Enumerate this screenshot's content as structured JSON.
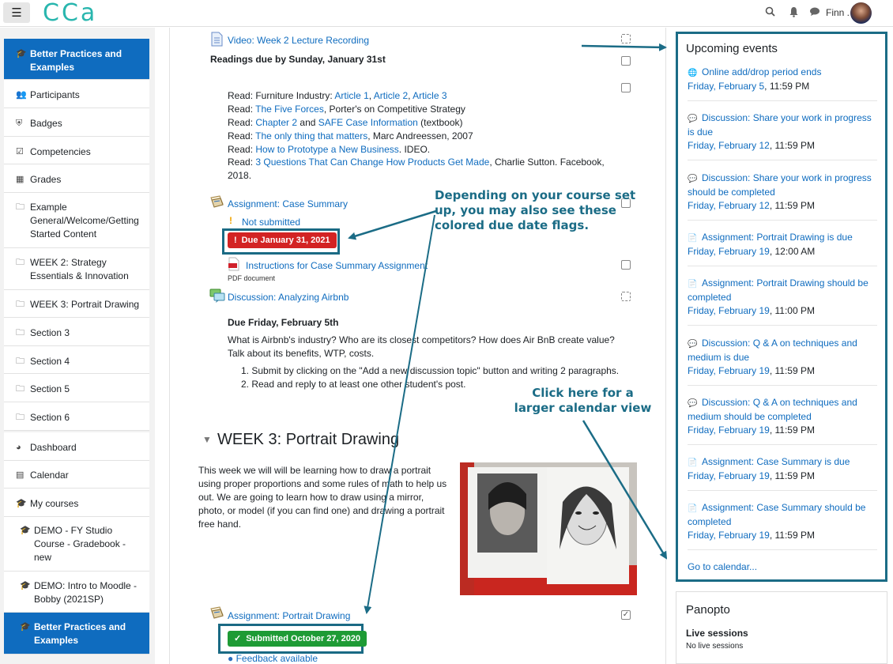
{
  "topbar": {
    "logo_text": "CCa",
    "user_name": "Finn ."
  },
  "leftnav": {
    "items": [
      {
        "label": "Better Practices and Examples",
        "icon": "graduation-cap-icon",
        "active": true
      },
      {
        "label": "Participants",
        "icon": "users-icon"
      },
      {
        "label": "Badges",
        "icon": "shield-icon"
      },
      {
        "label": "Competencies",
        "icon": "checkbox-icon"
      },
      {
        "label": "Grades",
        "icon": "table-icon"
      },
      {
        "label": "Example General/Welcome/Getting Started Content",
        "icon": "folder-icon"
      },
      {
        "label": "WEEK 2: Strategy Essentials & Innovation",
        "icon": "folder-icon"
      },
      {
        "label": "WEEK 3: Portrait Drawing",
        "icon": "folder-icon"
      },
      {
        "label": "Section 3",
        "icon": "folder-icon"
      },
      {
        "label": "Section 4",
        "icon": "folder-icon"
      },
      {
        "label": "Section 5",
        "icon": "folder-icon"
      },
      {
        "label": "Section 6",
        "icon": "folder-icon"
      }
    ],
    "items2": [
      {
        "label": "Dashboard",
        "icon": "dashboard-icon"
      },
      {
        "label": "Calendar",
        "icon": "calendar-icon"
      },
      {
        "label": "My courses",
        "icon": "graduation-cap-icon"
      },
      {
        "label": "DEMO - FY Studio Course - Gradebook - new",
        "icon": "graduation-cap-icon"
      },
      {
        "label": "DEMO: Intro to Moodle - Bobby (2021SP)",
        "icon": "graduation-cap-icon"
      },
      {
        "label": "Better Practices and Examples",
        "icon": "graduation-cap-icon",
        "active": true
      }
    ]
  },
  "main": {
    "video_link": "Video: Week 2 Lecture Recording",
    "readings_heading": "Readings due by Sunday, January 31st",
    "readings": {
      "r1_prefix": "Read: Furniture Industry: ",
      "r1_a1": "Article 1",
      "r1_a2": "Article 2",
      "r1_a3": "Article 3",
      "r2_prefix": "Read: ",
      "r2_link": "The Five Forces",
      "r2_suffix": ", Porter's on Competitive Strategy",
      "r3_prefix": "Read: ",
      "r3_link1": "Chapter 2",
      "r3_mid": " and ",
      "r3_link2": "SAFE Case Information",
      "r3_suffix": " (textbook)",
      "r4_prefix": "Read: ",
      "r4_link": "The only thing that matters",
      "r4_suffix": ", Marc Andreessen, 2007",
      "r5_prefix": "Read: ",
      "r5_link": "How to Prototype a New Business",
      "r5_suffix": ". IDEO.",
      "r6_prefix": "Read: ",
      "r6_link": "3 Questions That Can Change How Products Get Made",
      "r6_suffix": ", Charlie Sutton. Facebook,",
      "r6_line2": "2018."
    },
    "case_assignment": "Assignment: Case Summary",
    "not_submitted": "Not submitted",
    "due_flag": "Due January 31, 2021",
    "instructions_link": "Instructions for Case Summary Assignment",
    "pdf_label": "PDF document",
    "discussion_link": "Discussion: Analyzing Airbnb",
    "due_friday": "Due Friday, February 5th",
    "discussion_text": "What is Airbnb's industry? Who are its closest competitors? How does Air BnB create value? Talk about its benefits, WTP, costs.",
    "steps": [
      "Submit by clicking on the \"Add a new discussion topic\" button and writing 2 paragraphs.",
      "Read and reply to at least one other student's post."
    ],
    "week3_title": "WEEK 3: Portrait Drawing",
    "week3_text": "This week we will will be learning how to draw a portrait using proper proportions and some rules of math to help us out. We are going to learn how to draw using a mirror, photo, or model (if you can find one) and drawing a portrait free hand.",
    "portrait_assignment": "Assignment: Portrait Drawing",
    "submitted_flag": "Submitted October 27, 2020",
    "feedback_link": "Feedback available"
  },
  "annotations": {
    "flags_note": "Depending on your course set up, you may also see these colored due date flags.",
    "calendar_note": "Click here for a larger calendar view"
  },
  "events": {
    "title": "Upcoming events",
    "items": [
      {
        "title": "Online add/drop period ends",
        "day": "Friday, February 5",
        "time": ", 11:59 PM",
        "icon": "globe-icon"
      },
      {
        "title": "Discussion: Share your work in progress is due",
        "day": "Friday, February 12",
        "time": ", 11:59 PM",
        "icon": "forum-icon"
      },
      {
        "title": "Discussion: Share your work in progress should be completed",
        "day": "Friday, February 12",
        "time": ", 11:59 PM",
        "icon": "forum-icon"
      },
      {
        "title": "Assignment: Portrait Drawing is due",
        "day": "Friday, February 19",
        "time": ", 12:00 AM",
        "icon": "assignment-icon"
      },
      {
        "title": "Assignment: Portrait Drawing should be completed",
        "day": "Friday, February 19",
        "time": ", 11:00 PM",
        "icon": "assignment-icon"
      },
      {
        "title": "Discussion: Q & A on techniques and medium is due",
        "day": "Friday, February 19",
        "time": ", 11:59 PM",
        "icon": "forum-icon"
      },
      {
        "title": "Discussion: Q & A on techniques and medium should be completed",
        "day": "Friday, February 19",
        "time": ", 11:59 PM",
        "icon": "forum-icon"
      },
      {
        "title": "Assignment: Case Summary is due",
        "day": "Friday, February 19",
        "time": ", 11:59 PM",
        "icon": "assignment-icon"
      },
      {
        "title": "Assignment: Case Summary should be completed",
        "day": "Friday, February 19",
        "time": ", 11:59 PM",
        "icon": "assignment-icon"
      }
    ],
    "goto": "Go to calendar..."
  },
  "panopto": {
    "title": "Panopto",
    "live": "Live sessions",
    "none": "No live sessions"
  }
}
